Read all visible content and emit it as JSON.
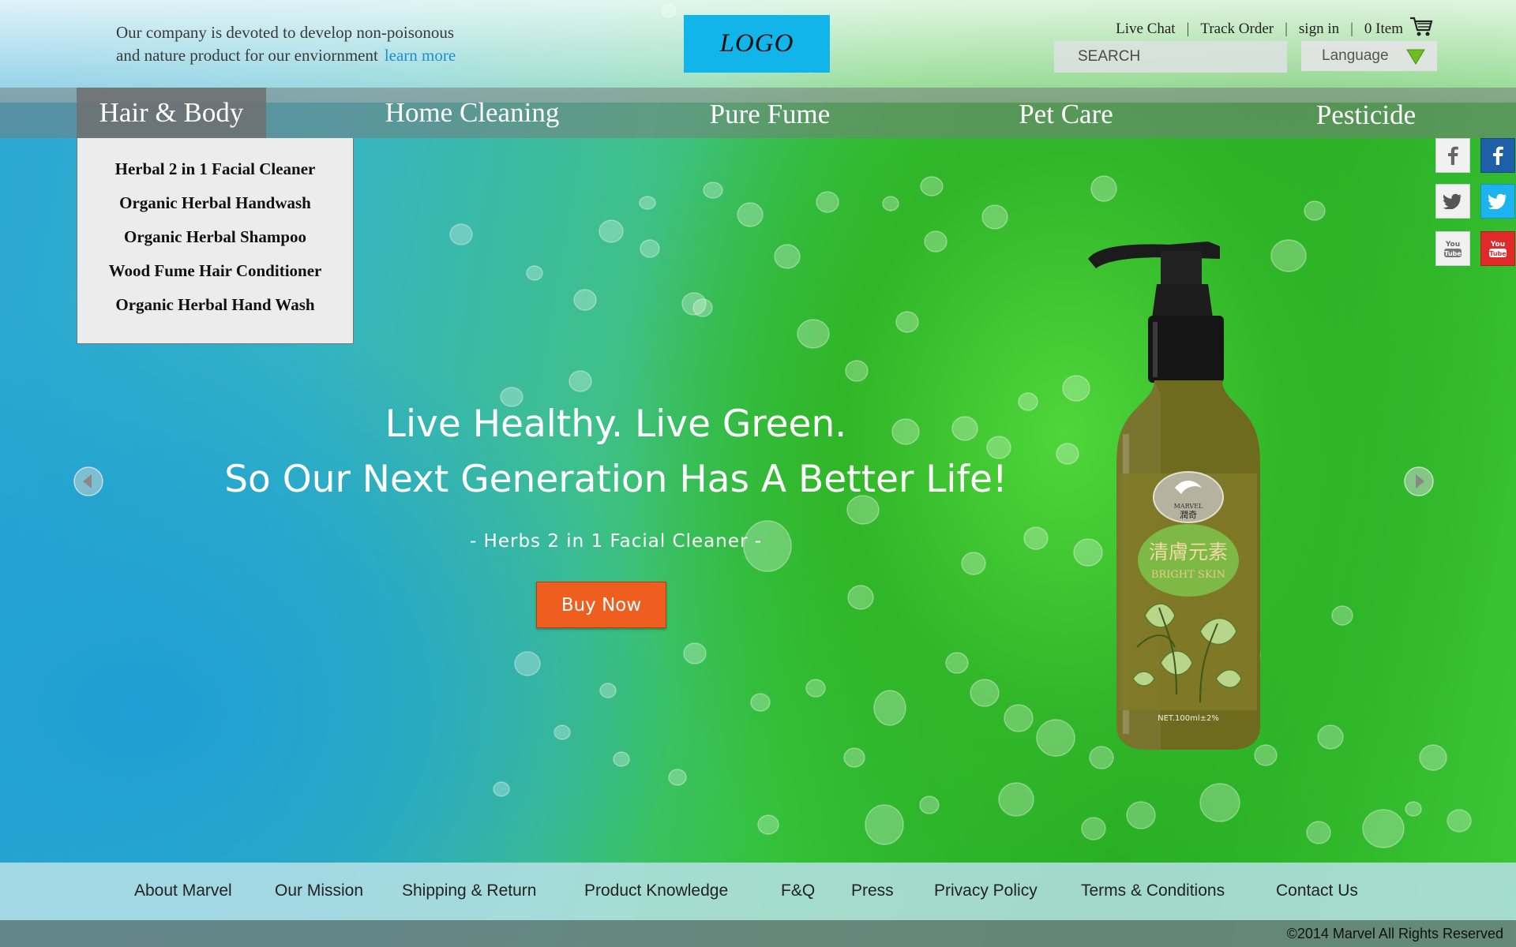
{
  "header": {
    "tagline_line1": "Our company is devoted to develop non-poisonous",
    "tagline_line2": "and nature product for our enviornment",
    "learn_more": "learn more",
    "logo": "LOGO",
    "links": {
      "live_chat": "Live Chat",
      "track_order": "Track Order",
      "sign_in": "sign in",
      "cart": "0 Item"
    },
    "search_placeholder": "SEARCH",
    "language": "Language"
  },
  "nav": {
    "items": [
      {
        "label": "Hair & Body",
        "active": true
      },
      {
        "label": "Home Cleaning",
        "active": false
      },
      {
        "label": "Pure Fume",
        "active": false
      },
      {
        "label": "Pet Care",
        "active": false
      },
      {
        "label": "Pesticide",
        "active": false
      }
    ],
    "dropdown": [
      "Herbal 2 in 1 Facial Cleaner",
      "Organic Herbal Handwash",
      "Organic Herbal Shampoo",
      "Wood Fume Hair Conditioner",
      "Organic Herbal Hand Wash"
    ]
  },
  "social": [
    "facebook-icon",
    "twitter-icon",
    "youtube-icon"
  ],
  "hero": {
    "line1": "Live Healthy. Live Green.",
    "line2": "So Our Next Generation Has A Better Life!",
    "subtitle": "- Herbs 2 in 1 Facial Cleaner -",
    "button": "Buy Now",
    "product_brand": "MARVEL",
    "product_brand_cn": "潤奇",
    "product_label_cn": "清膚元素",
    "product_label_en": "BRIGHT SKIN",
    "product_volume": "NET.100ml±2%"
  },
  "footer": {
    "links": [
      "About Marvel",
      "Our Mission",
      "Shipping & Return",
      "Product Knowledge",
      "F&Q",
      "Press",
      "Privacy Policy",
      "Terms & Conditions",
      "Contact Us"
    ],
    "copyright": "©2014 Marvel  All Rights Reserved"
  },
  "colors": {
    "logo_bg": "#12b5ea",
    "buy_button": "#ef5d1f",
    "learn_more": "#1a8fd8",
    "facebook": "#1f5fa8",
    "twitter": "#1cb3ef",
    "youtube": "#e02a2a"
  }
}
